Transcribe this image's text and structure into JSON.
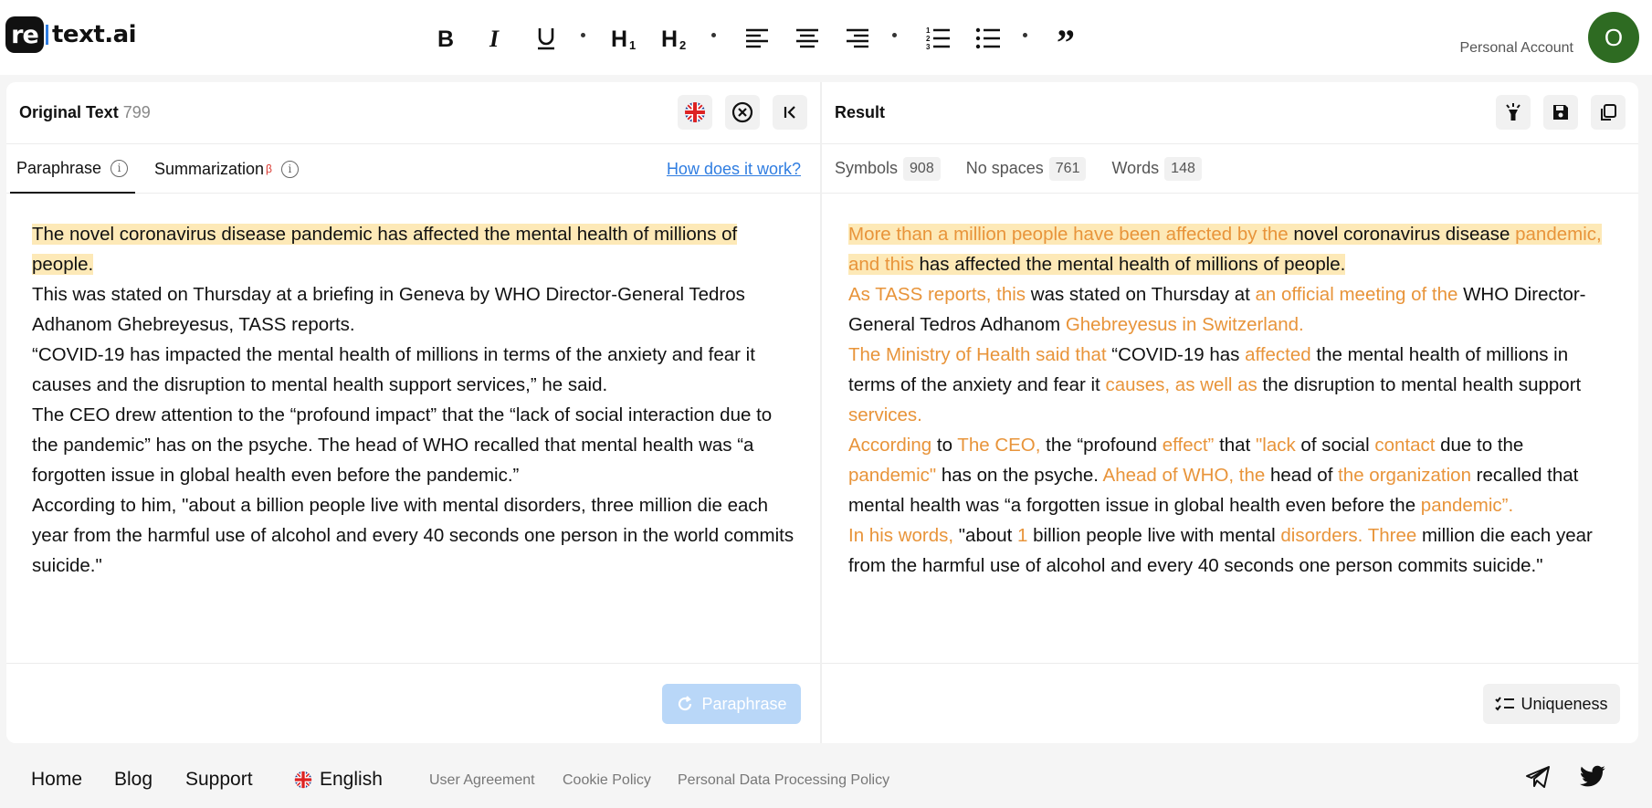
{
  "app": {
    "logo_prefix": "re",
    "logo_name": "text.ai"
  },
  "header": {
    "account_label": "Personal Account",
    "avatar_letter": "O"
  },
  "left": {
    "title": "Original Text",
    "count": "799",
    "tab_paraphrase": "Paraphrase",
    "tab_summarization": "Summarization",
    "beta_mark": "β",
    "how_link": "How does it work?",
    "paraphrase_button": "Paraphrase",
    "paragraphs": [
      "The novel coronavirus disease pandemic has affected the mental health of millions of people.",
      "This was stated on Thursday at a briefing in Geneva by WHO Director-General Tedros Adhanom Ghebreyesus, TASS reports.",
      "“COVID-19 has impacted the mental health of millions in terms of the anxiety and fear it causes and the disruption to mental health support services,” he said.",
      "The CEO drew attention to the “profound impact” that the “lack of social interaction due to the pandemic” has on the psyche. The head of WHO recalled that mental health was “a forgotten issue in global health even before the pandemic.”",
      "According to him, \"about a billion people live with mental disorders, three million die each year from the harmful use of alcohol and every 40 seconds one person in the world commits suicide.\""
    ]
  },
  "right": {
    "title": "Result",
    "stats": {
      "symbols_label": "Symbols",
      "symbols": "908",
      "nospaces_label": "No spaces",
      "nospaces": "761",
      "words_label": "Words",
      "words": "148"
    },
    "uniqueness_button": "Uniqueness",
    "paragraphs": [
      [
        {
          "t": "More than a million people have been affected by the ",
          "c": true,
          "h": true
        },
        {
          "t": "novel coronavirus disease ",
          "c": false,
          "h": true
        },
        {
          "t": "pandemic, and this",
          "c": true,
          "h": true
        },
        {
          "t": " has affected the mental health of millions of people.",
          "c": false,
          "h": true
        }
      ],
      [
        {
          "t": "As TASS reports, this",
          "c": true
        },
        {
          "t": " was stated on Thursday at ",
          "c": false
        },
        {
          "t": "an official meeting of the",
          "c": true
        },
        {
          "t": " WHO Director-General Tedros Adhanom ",
          "c": false
        },
        {
          "t": "Ghebreyesus in Switzerland.",
          "c": true
        }
      ],
      [
        {
          "t": "The Ministry of Health said that",
          "c": true
        },
        {
          "t": " “COVID-19 has ",
          "c": false
        },
        {
          "t": "affected",
          "c": true
        },
        {
          "t": " the mental health of millions in terms of the anxiety and fear it ",
          "c": false
        },
        {
          "t": "causes, as well as",
          "c": true
        },
        {
          "t": " the disruption to mental health support ",
          "c": false
        },
        {
          "t": "services.",
          "c": true
        }
      ],
      [
        {
          "t": "According",
          "c": true
        },
        {
          "t": " to ",
          "c": false
        },
        {
          "t": "The CEO,",
          "c": true
        },
        {
          "t": " the “profound ",
          "c": false
        },
        {
          "t": "effect”",
          "c": true
        },
        {
          "t": " that ",
          "c": false
        },
        {
          "t": "\"lack",
          "c": true
        },
        {
          "t": " of social ",
          "c": false
        },
        {
          "t": "contact",
          "c": true
        },
        {
          "t": " due to the ",
          "c": false
        },
        {
          "t": "pandemic\"",
          "c": true
        },
        {
          "t": " has on the psyche. ",
          "c": false
        },
        {
          "t": "Ahead of WHO, the",
          "c": true
        },
        {
          "t": " head of ",
          "c": false
        },
        {
          "t": "the organization",
          "c": true
        },
        {
          "t": " recalled that mental health was “a forgotten issue in global health even before the ",
          "c": false
        },
        {
          "t": "pandemic”.",
          "c": true
        }
      ],
      [
        {
          "t": "In his words,",
          "c": true
        },
        {
          "t": " \"about ",
          "c": false
        },
        {
          "t": "1",
          "c": true
        },
        {
          "t": " billion people live with mental ",
          "c": false
        },
        {
          "t": "disorders. Three",
          "c": true
        },
        {
          "t": " million die each year from the harmful use of alcohol and every 40 seconds one person commits suicide.\"",
          "c": false
        }
      ]
    ]
  },
  "footer": {
    "home": "Home",
    "blog": "Blog",
    "support": "Support",
    "language": "English",
    "user_agreement": "User Agreement",
    "cookie_policy": "Cookie Policy",
    "data_policy": "Personal Data Processing Policy"
  },
  "icons": {
    "bold": "bold-icon",
    "italic": "italic-icon",
    "underline": "underline-icon",
    "h1": "heading1-icon",
    "h2": "heading2-icon",
    "align_left": "align-left-icon",
    "align_center": "align-center-icon",
    "align_right": "align-right-icon",
    "ordered_list": "ordered-list-icon",
    "bullet_list": "bullet-list-icon",
    "quote": "quote-icon",
    "flag": "uk-flag-icon",
    "clear": "clear-icon",
    "collapse": "collapse-icon",
    "flashlight": "flashlight-icon",
    "save": "save-icon",
    "copy": "copy-icon",
    "telegram": "telegram-icon",
    "twitter": "twitter-icon"
  },
  "colors": {
    "changed_text": "#e8943a",
    "highlight": "#fde9b7",
    "link": "#2f7de1",
    "avatar": "#2e6b22",
    "button_disabled": "#b9d7f8"
  }
}
